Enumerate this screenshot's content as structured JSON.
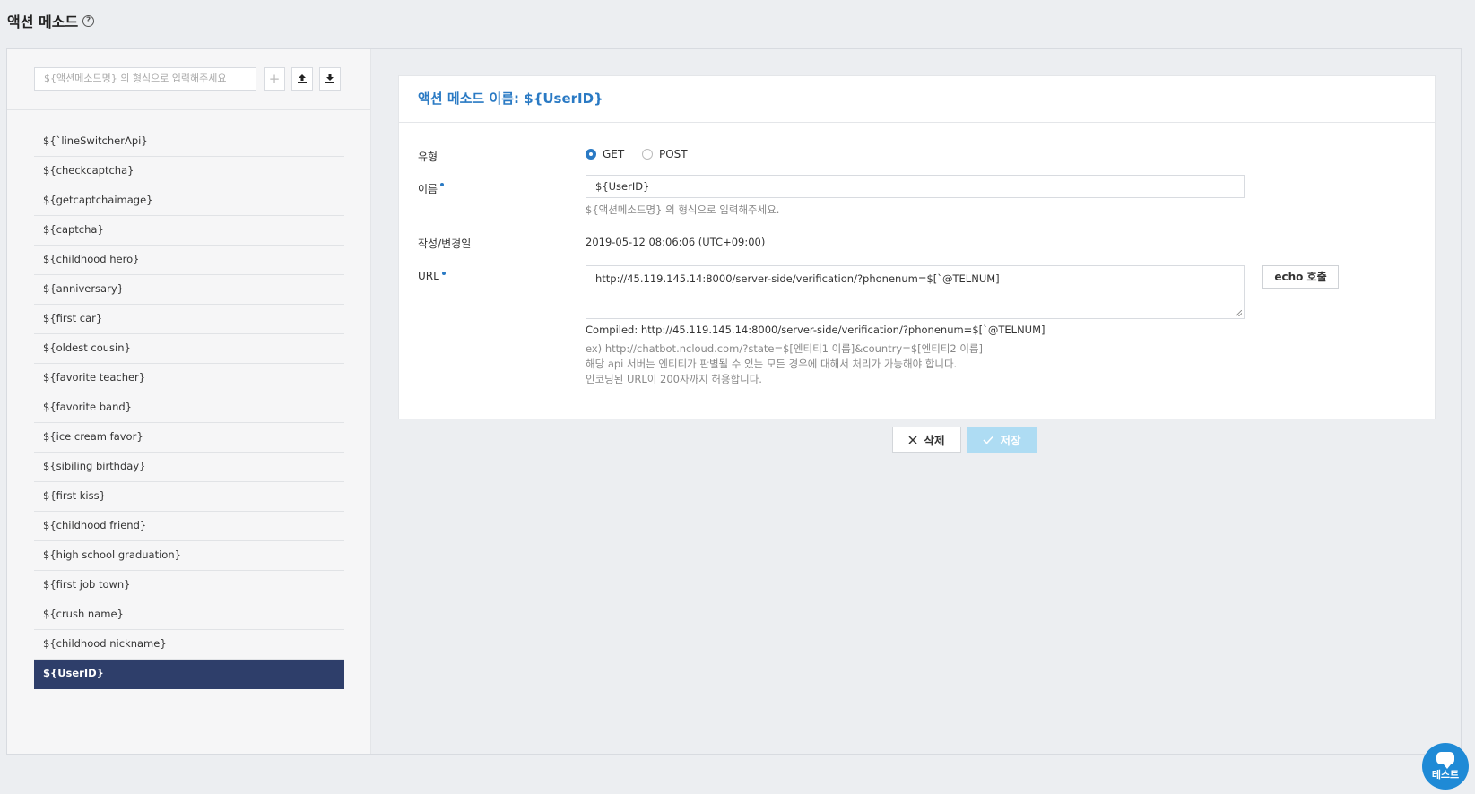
{
  "page": {
    "title": "액션 메소드",
    "help_icon": "question-circle-icon"
  },
  "sidebar": {
    "search_placeholder": "${액션메소드명} 의 형식으로 입력해주세요",
    "add_label": "+",
    "items": [
      "${`lineSwitcherApi}",
      "${checkcaptcha}",
      "${getcaptchaimage}",
      "${captcha}",
      "${childhood hero}",
      "${anniversary}",
      "${first car}",
      "${oldest cousin}",
      "${favorite teacher}",
      "${favorite band}",
      "${ice cream favor}",
      "${sibiling birthday}",
      "${first kiss}",
      "${childhood friend}",
      "${high school graduation}",
      "${first job town}",
      "${crush name}",
      "${childhood nickname}",
      "${UserID}"
    ],
    "active_index": 18
  },
  "detail": {
    "header": "액션 메소드 이름: ${UserID}",
    "type_label": "유형",
    "type_options": [
      "GET",
      "POST"
    ],
    "type_selected": "GET",
    "name_label": "이름",
    "name_value": "${UserID}",
    "name_hint": "${액션메소드명} 의 형식으로 입력해주세요.",
    "date_label": "작성/변경일",
    "date_value": "2019-05-12 08:06:06 (UTC+09:00)",
    "url_label": "URL",
    "url_value": "http://45.119.145.14:8000/server-side/verification/?phonenum=$[`@TELNUM]",
    "echo_label": "echo 호출",
    "compiled": "Compiled: http://45.119.145.14:8000/server-side/verification/?phonenum=$[`@TELNUM]",
    "url_hints": [
      "ex) http://chatbot.ncloud.com/?state=$[엔티티1 이름]&country=$[엔티티2 이름]",
      "해당 api 서버는 엔티티가 판별될 수 있는 모든 경우에 대해서 처리가 가능해야 합니다.",
      "인코딩된 URL이 200자까지 허용합니다."
    ]
  },
  "actions": {
    "delete_label": "삭제",
    "save_label": "저장"
  },
  "fab": {
    "label": "테스트",
    "icon": "chat-bubble-icon"
  },
  "colors": {
    "accent": "#2a7ac4",
    "active_item": "#2e3e6a",
    "save_disabled": "#aedcf3",
    "fab": "#1f8ad6"
  }
}
